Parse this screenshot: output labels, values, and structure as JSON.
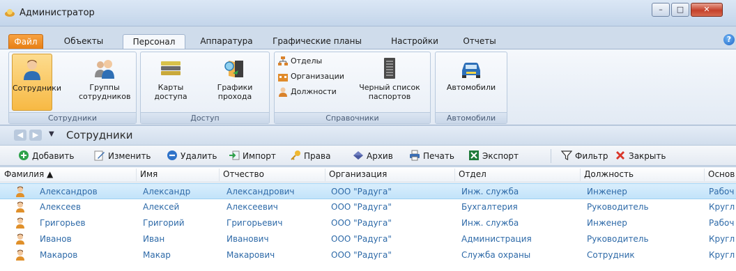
{
  "window": {
    "title": "Администратор",
    "min_label": "–",
    "max_label": "□",
    "close_label": "✕"
  },
  "tabs": [
    {
      "label": "Файл"
    },
    {
      "label": "Объекты"
    },
    {
      "label": "Персонал"
    },
    {
      "label": "Аппаратура"
    },
    {
      "label": "Графические планы"
    },
    {
      "label": "Настройки"
    },
    {
      "label": "Отчеты"
    }
  ],
  "help_label": "?",
  "ribbon": {
    "groups": [
      {
        "label": "Сотрудники",
        "buttons": [
          "Сотрудники",
          "Группы сотрудников"
        ]
      },
      {
        "label": "Доступ",
        "buttons": [
          "Карты доступа",
          "Графики прохода"
        ]
      },
      {
        "label": "Справочники",
        "small": [
          "Отделы",
          "Организации",
          "Должности"
        ],
        "buttons": [
          "Черный список паспортов"
        ]
      },
      {
        "label": "Автомобили",
        "buttons": [
          "Автомобили"
        ]
      }
    ]
  },
  "nav": {
    "back": "◀",
    "forward": "▶",
    "dropdown": "▼",
    "breadcrumb": "Сотрудники"
  },
  "toolbar": [
    {
      "label": "Добавить",
      "icon": "add-icon"
    },
    {
      "label": "Изменить",
      "icon": "edit-icon"
    },
    {
      "label": "Удалить",
      "icon": "delete-icon"
    },
    {
      "label": "Импорт",
      "icon": "import-icon"
    },
    {
      "label": "Права",
      "icon": "key-icon"
    },
    {
      "label": "Архив",
      "icon": "archive-icon"
    },
    {
      "label": "Печать",
      "icon": "print-icon"
    },
    {
      "label": "Экспорт",
      "icon": "excel-icon"
    },
    {
      "label": "Фильтр",
      "icon": "filter-icon"
    },
    {
      "label": "Закрыть",
      "icon": "close-icon"
    }
  ],
  "table": {
    "columns": [
      "Фамилия ▲",
      "Имя",
      "Отчество",
      "Организация",
      "Отдел",
      "Должность",
      "Основ"
    ],
    "rows": [
      [
        "Александров",
        "Александр",
        "Александрович",
        "ООО \"Радуга\"",
        "Инж. служба",
        "Инженер",
        "Рабоч"
      ],
      [
        "Алексеев",
        "Алексей",
        "Алексеевич",
        "ООО \"Радуга\"",
        "Бухгалтерия",
        "Руководитель",
        "Кругл"
      ],
      [
        "Григорьев",
        "Григорий",
        "Григорьевич",
        "ООО \"Радуга\"",
        "Инж. служба",
        "Инженер",
        "Рабоч"
      ],
      [
        "Иванов",
        "Иван",
        "Иванович",
        "ООО \"Радуга\"",
        "Администрация",
        "Руководитель",
        "Кругл"
      ],
      [
        "Макаров",
        "Макар",
        "Макарович",
        "ООО \"Радуга\"",
        "Служба охраны",
        "Сотрудник",
        "Кругл"
      ]
    ]
  }
}
